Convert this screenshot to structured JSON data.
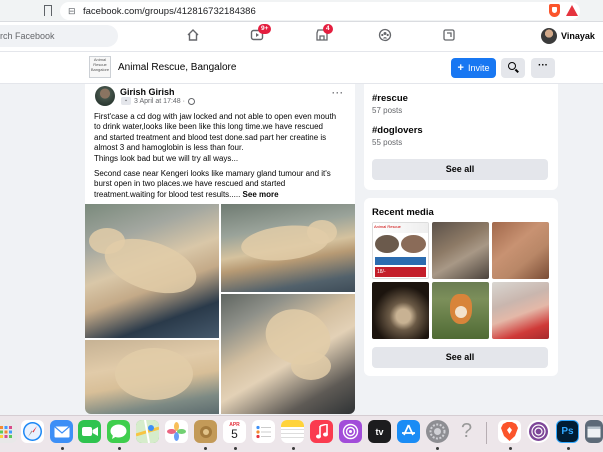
{
  "browser": {
    "url": "facebook.com/groups/412816732184386",
    "lock_icon": "lock-icon",
    "bookmark_icon": "bookmark-icon"
  },
  "nav": {
    "search_placeholder": "rch Facebook",
    "icons": [
      {
        "name": "home-icon"
      },
      {
        "name": "watch-icon",
        "badge": "9+"
      },
      {
        "name": "marketplace-icon",
        "badge": "4"
      },
      {
        "name": "groups-icon"
      },
      {
        "name": "gaming-icon"
      }
    ],
    "profile_name": "Vinayak"
  },
  "group": {
    "thumb_text": "Animal Rescue Bangalore",
    "name": "Animal Rescue, Bangalore",
    "invite_label": "Invite",
    "more_label": "···"
  },
  "post": {
    "author": "Girish Girish",
    "timestamp": "3 April at 17:48 ·",
    "more_label": "···",
    "paragraph1_line1": "First'case a cd dog with jaw locked and not able to open even mouth",
    "paragraph1_line2": "to drink water,looks like been like this long time.we have rescued",
    "paragraph1_line3": "and started treatment and blood test done.sad part her creatine is",
    "paragraph1_line4": "almost 3 and hamoglobin is less than four.",
    "paragraph1_line5": "Things look bad but we will try all ways...",
    "paragraph2_line1": "Second case near Kengeri looks like mamary gland tumour and it's",
    "paragraph2_line2": "burst open in two places.we have rescued and started",
    "paragraph2_line3": "treatment.waiting for blood test results.....",
    "see_more": "See more"
  },
  "sidebar": {
    "hashtags": [
      {
        "tag": "#rescue",
        "count": "57 posts"
      },
      {
        "tag": "#doglovers",
        "count": "55 posts"
      }
    ],
    "see_all_label": "See all",
    "recent_media_title": "Recent media",
    "media_see_all_label": "See all",
    "thumb1_header": "Animal Rescue",
    "thumb1_bar": "",
    "thumb1_red": "18/-"
  },
  "dock": {
    "apps": [
      {
        "name": "launchpad-icon",
        "color": "#e8e8e8"
      },
      {
        "name": "safari-icon",
        "color": "#1b87f5"
      },
      {
        "name": "mail-icon",
        "color": "#3d8ff6"
      },
      {
        "name": "facetime-icon",
        "color": "#2fc34f"
      },
      {
        "name": "messages-icon",
        "color": "#3fce4d"
      },
      {
        "name": "maps-icon",
        "color": "#61bd5f"
      },
      {
        "name": "photos-icon",
        "color": "#ffffff"
      },
      {
        "name": "keychain-icon",
        "color": "#c39a58"
      },
      {
        "name": "calendar-icon",
        "color": "#ffffff"
      },
      {
        "name": "reminders-icon",
        "color": "#ffffff"
      },
      {
        "name": "notes-icon",
        "color": "#ffd33b"
      },
      {
        "name": "music-icon",
        "color": "#fa3b4f"
      },
      {
        "name": "podcasts-icon",
        "color": "#a24cd9"
      },
      {
        "name": "apple-tv-icon",
        "color": "#1c1c1e"
      },
      {
        "name": "app-store-icon",
        "color": "#1a8cf5"
      },
      {
        "name": "system-preferences-icon",
        "color": "#8e8e93"
      },
      {
        "name": "help-icon",
        "color": "#d9d9d9"
      },
      {
        "name": "brave-icon",
        "color": "#fb542b"
      },
      {
        "name": "tor-browser-icon",
        "color": "#7d4698"
      },
      {
        "name": "photoshop-icon",
        "color": "#001d34"
      },
      {
        "name": "finder-window-icon",
        "color": "#5d6a78"
      }
    ],
    "calendar_month": "APR",
    "calendar_day": "5",
    "tv_label": "tv",
    "ps_label": "Ps"
  }
}
